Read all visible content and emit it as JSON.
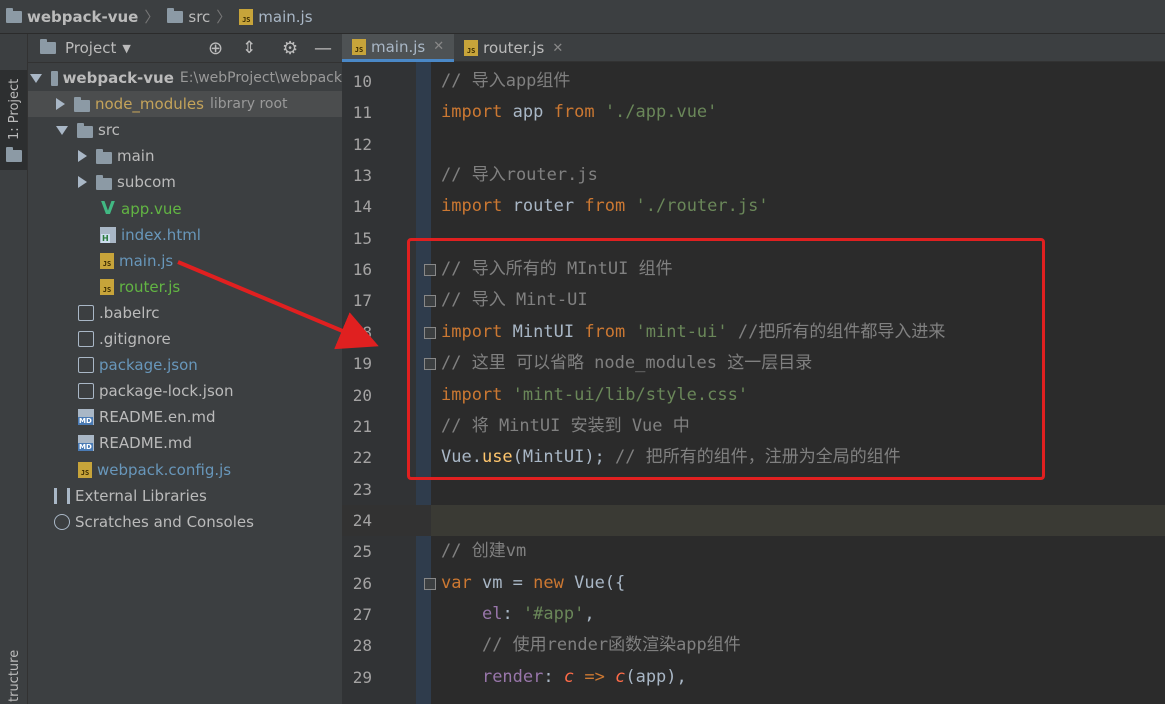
{
  "breadcrumb": {
    "project": "webpack-vue",
    "folder": "src",
    "file": "main.js"
  },
  "side_strip": {
    "project_tab": "1: Project",
    "structure_tab": "tructure"
  },
  "panel": {
    "title": "Project"
  },
  "tree": [
    {
      "label": "webpack-vue",
      "suffix": "E:\\webProject\\webpack",
      "icon": "folder",
      "level": 0,
      "expanded": true,
      "color": "#bbbbbb",
      "bold": true
    },
    {
      "label": "node_modules",
      "suffix": "library root",
      "icon": "folder-lib",
      "level": 1,
      "expanded": false,
      "color": "#c4a35a"
    },
    {
      "label": "src",
      "icon": "folder",
      "level": 1,
      "expanded": true,
      "color": "#bbbbbb"
    },
    {
      "label": "main",
      "icon": "folder",
      "level": 2,
      "expanded": false,
      "color": "#bbbbbb"
    },
    {
      "label": "subcom",
      "icon": "folder",
      "level": 2,
      "expanded": false,
      "color": "#bbbbbb"
    },
    {
      "label": "app.vue",
      "icon": "vue",
      "level": 3,
      "color": "#62b543"
    },
    {
      "label": "index.html",
      "icon": "html",
      "level": 3,
      "color": "#6897bb"
    },
    {
      "label": "main.js",
      "icon": "js",
      "level": 3,
      "color": "#6897bb"
    },
    {
      "label": "router.js",
      "icon": "js",
      "level": 3,
      "color": "#62b543"
    },
    {
      "label": ".babelrc",
      "icon": "cfg",
      "level": 2,
      "color": "#bbbbbb"
    },
    {
      "label": ".gitignore",
      "icon": "cfg",
      "level": 2,
      "color": "#bbbbbb"
    },
    {
      "label": "package.json",
      "icon": "cfg",
      "level": 2,
      "color": "#6897bb"
    },
    {
      "label": "package-lock.json",
      "icon": "cfg",
      "level": 2,
      "color": "#bbbbbb"
    },
    {
      "label": "README.en.md",
      "icon": "md",
      "level": 2,
      "color": "#bbbbbb"
    },
    {
      "label": "README.md",
      "icon": "md",
      "level": 2,
      "color": "#bbbbbb"
    },
    {
      "label": "webpack.config.js",
      "icon": "js",
      "level": 2,
      "color": "#6897bb"
    },
    {
      "label": "External Libraries",
      "icon": "lib",
      "level": -1,
      "color": "#bbbbbb"
    },
    {
      "label": "Scratches and Consoles",
      "icon": "scr",
      "level": -1,
      "color": "#bbbbbb"
    }
  ],
  "tabs": [
    {
      "label": "main.js",
      "active": true
    },
    {
      "label": "router.js",
      "active": false
    }
  ],
  "code": [
    {
      "n": "10",
      "t": [
        [
          "cm",
          "// 导入app组件"
        ]
      ]
    },
    {
      "n": "11",
      "t": [
        [
          "kw",
          "import"
        ],
        [
          "",
          " app "
        ],
        [
          "kw",
          "from"
        ],
        [
          "",
          " "
        ],
        [
          "str",
          "'./app.vue'"
        ]
      ]
    },
    {
      "n": "12",
      "t": []
    },
    {
      "n": "13",
      "t": [
        [
          "cm",
          "// 导入router.js"
        ]
      ]
    },
    {
      "n": "14",
      "t": [
        [
          "kw",
          "import"
        ],
        [
          "",
          " router "
        ],
        [
          "kw",
          "from"
        ],
        [
          "",
          " "
        ],
        [
          "str",
          "'./router.js'"
        ]
      ]
    },
    {
      "n": "15",
      "t": []
    },
    {
      "n": "16",
      "t": [
        [
          "cm",
          "// 导入所有的 MIntUI 组件"
        ]
      ],
      "fold": true
    },
    {
      "n": "17",
      "t": [
        [
          "cm",
          "// 导入 Mint-UI"
        ]
      ],
      "fold": true
    },
    {
      "n": "18",
      "t": [
        [
          "kw",
          "import"
        ],
        [
          "",
          " MintUI "
        ],
        [
          "kw",
          "from"
        ],
        [
          "",
          " "
        ],
        [
          "str",
          "'mint-ui'"
        ],
        [
          "",
          " "
        ],
        [
          "cm",
          "//把所有的组件都导入进来"
        ]
      ],
      "fold": true
    },
    {
      "n": "19",
      "t": [
        [
          "cm",
          "// 这里 可以省略 node_modules 这一层目录"
        ]
      ],
      "fold": true
    },
    {
      "n": "20",
      "t": [
        [
          "kw",
          "import"
        ],
        [
          "",
          " "
        ],
        [
          "str",
          "'mint-ui/lib/style.css'"
        ]
      ]
    },
    {
      "n": "21",
      "t": [
        [
          "cm",
          "// 将 MintUI 安装到 Vue 中"
        ]
      ]
    },
    {
      "n": "22",
      "t": [
        [
          "",
          "Vue."
        ],
        [
          "fn",
          "use"
        ],
        [
          "",
          "(MintUI); "
        ],
        [
          "cm",
          "// 把所有的组件，注册为全局的组件"
        ]
      ]
    },
    {
      "n": "23",
      "t": []
    },
    {
      "n": "24",
      "t": [],
      "current": true
    },
    {
      "n": "25",
      "t": [
        [
          "cm",
          "// 创建vm"
        ]
      ]
    },
    {
      "n": "26",
      "t": [
        [
          "kw",
          "var"
        ],
        [
          "",
          " vm = "
        ],
        [
          "kw",
          "new"
        ],
        [
          "",
          " Vue({"
        ]
      ],
      "fold": true
    },
    {
      "n": "27",
      "t": [
        [
          "",
          "    "
        ],
        [
          "prop",
          "el"
        ],
        [
          "",
          ": "
        ],
        [
          "str",
          "'#app'"
        ],
        [
          "",
          ","
        ]
      ]
    },
    {
      "n": "28",
      "t": [
        [
          "",
          "    "
        ],
        [
          "cm",
          "// 使用render函数渲染app组件"
        ]
      ]
    },
    {
      "n": "29",
      "t": [
        [
          "",
          "    "
        ],
        [
          "prop",
          "render"
        ],
        [
          "",
          ": "
        ],
        [
          "it",
          "c"
        ],
        [
          "",
          " "
        ],
        [
          "kw",
          "=>"
        ],
        [
          "",
          " "
        ],
        [
          "it",
          "c"
        ],
        [
          "",
          "(app),"
        ]
      ]
    }
  ],
  "colors": {
    "accent": "#4a88c7",
    "highlight_box": "#e02020",
    "arrow": "#e02020"
  }
}
